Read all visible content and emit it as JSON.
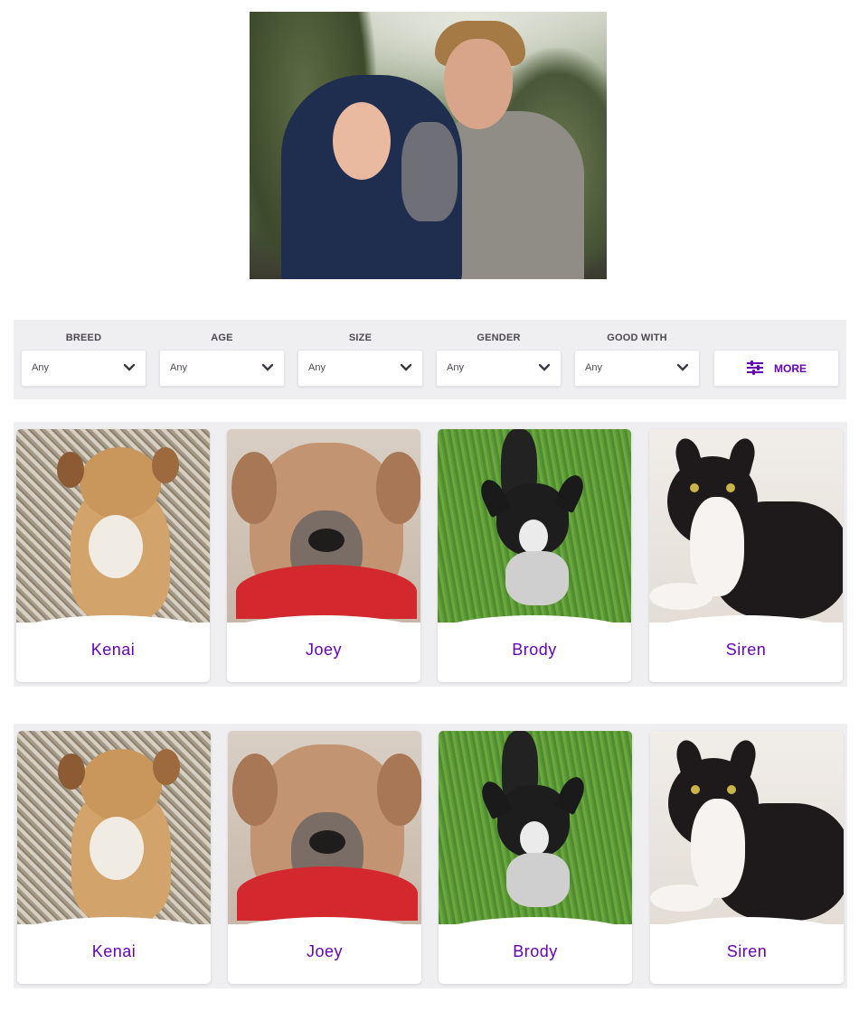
{
  "hero": {
    "image_alt": "Couple holding a grey puppy"
  },
  "filters": {
    "breed": {
      "label": "BREED",
      "value": "Any"
    },
    "age": {
      "label": "AGE",
      "value": "Any"
    },
    "size": {
      "label": "SIZE",
      "value": "Any"
    },
    "gender": {
      "label": "GENDER",
      "value": "Any"
    },
    "good_with": {
      "label": "GOOD WITH",
      "value": "Any"
    },
    "more_label": "MORE"
  },
  "pets_row_1": [
    {
      "name": "Kenai"
    },
    {
      "name": "Joey"
    },
    {
      "name": "Brody"
    },
    {
      "name": "Siren"
    }
  ],
  "pets_row_2": [
    {
      "name": "Kenai"
    },
    {
      "name": "Joey"
    },
    {
      "name": "Brody"
    },
    {
      "name": "Siren"
    }
  ],
  "colors": {
    "accent": "#6504b5",
    "panel": "#efeff2",
    "label_text": "#4d4751"
  }
}
